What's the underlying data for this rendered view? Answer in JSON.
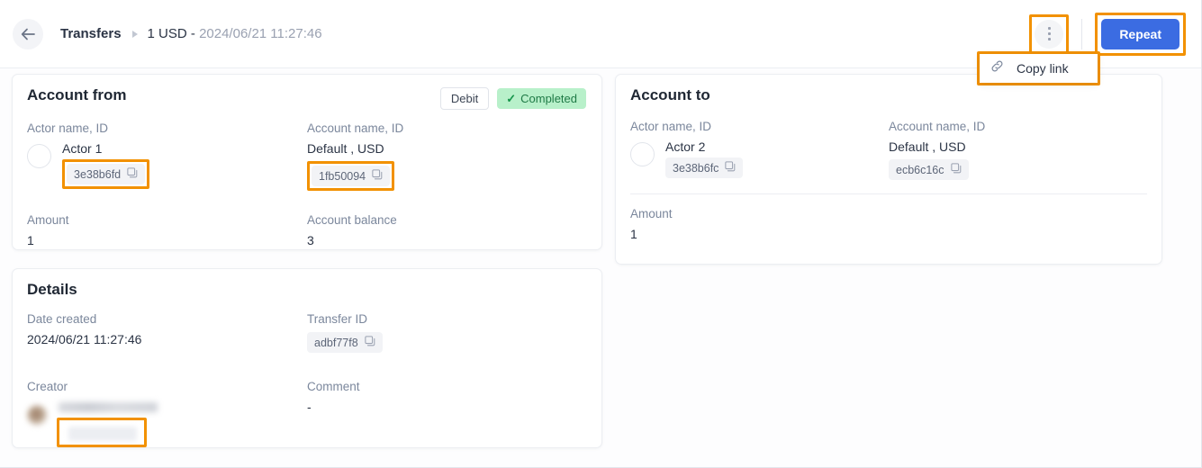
{
  "header": {
    "back_icon": "arrow-left-icon",
    "breadcrumb_root": "Transfers",
    "breadcrumb_current_prefix": "1 USD - ",
    "breadcrumb_current_date": "2024/06/21 11:27:46",
    "more_icon": "vertical-dots-icon",
    "repeat_label": "Repeat"
  },
  "menu": {
    "copy_link_label": "Copy link",
    "copy_link_icon": "link-icon"
  },
  "account_from": {
    "title": "Account from",
    "badge_type": "Debit",
    "badge_status": "Completed",
    "status_icon": "check-icon",
    "actor_label": "Actor name, ID",
    "actor_name": "Actor 1",
    "actor_id": "3e38b6fd",
    "account_label": "Account name, ID",
    "account_name": "Default , USD",
    "account_id": "1fb50094",
    "amount_label": "Amount",
    "amount_value": "1",
    "balance_label": "Account balance",
    "balance_value": "3"
  },
  "account_to": {
    "title": "Account to",
    "actor_label": "Actor name, ID",
    "actor_name": "Actor 2",
    "actor_id": "3e38b6fc",
    "account_label": "Account name, ID",
    "account_name": "Default , USD",
    "account_id": "ecb6c16c",
    "amount_label": "Amount",
    "amount_value": "1"
  },
  "details": {
    "title": "Details",
    "date_label": "Date created",
    "date_value": "2024/06/21 11:27:46",
    "transfer_id_label": "Transfer ID",
    "transfer_id_value": "adbf77f8",
    "creator_label": "Creator",
    "creator_name": "",
    "creator_id": "",
    "comment_label": "Comment",
    "comment_value": "-"
  },
  "colors": {
    "accent_blue": "#3b6ce2",
    "highlight_orange": "#f29100",
    "status_green_bg": "#b8f0ca",
    "status_green_text": "#1f7a46",
    "label_slate": "#7b879c"
  }
}
